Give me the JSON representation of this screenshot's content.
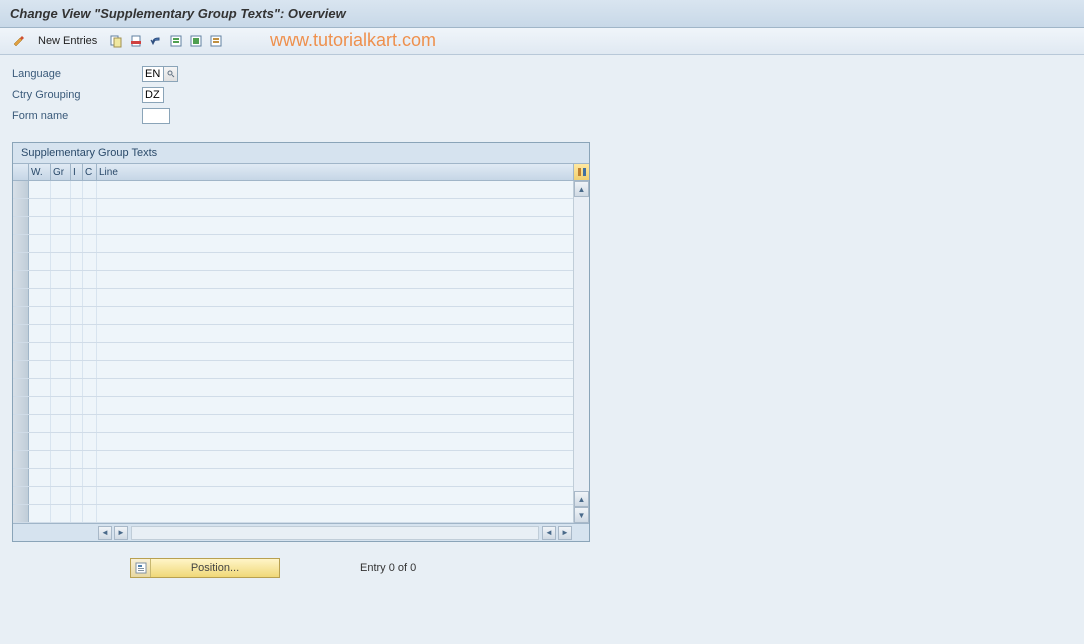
{
  "title": "Change View \"Supplementary Group Texts\": Overview",
  "toolbar": {
    "new_entries": "New Entries"
  },
  "watermark": "www.tutorialkart.com",
  "form": {
    "language_label": "Language",
    "language_value": "EN",
    "ctry_label": "Ctry Grouping",
    "ctry_value": "DZ",
    "form_name_label": "Form name",
    "form_name_value": ""
  },
  "table": {
    "title": "Supplementary Group Texts",
    "columns": {
      "w": "W.",
      "gr": "Gr",
      "i": "I",
      "c": "C",
      "line": "Line"
    }
  },
  "footer": {
    "position_label": "Position...",
    "entry_text": "Entry 0 of 0"
  }
}
